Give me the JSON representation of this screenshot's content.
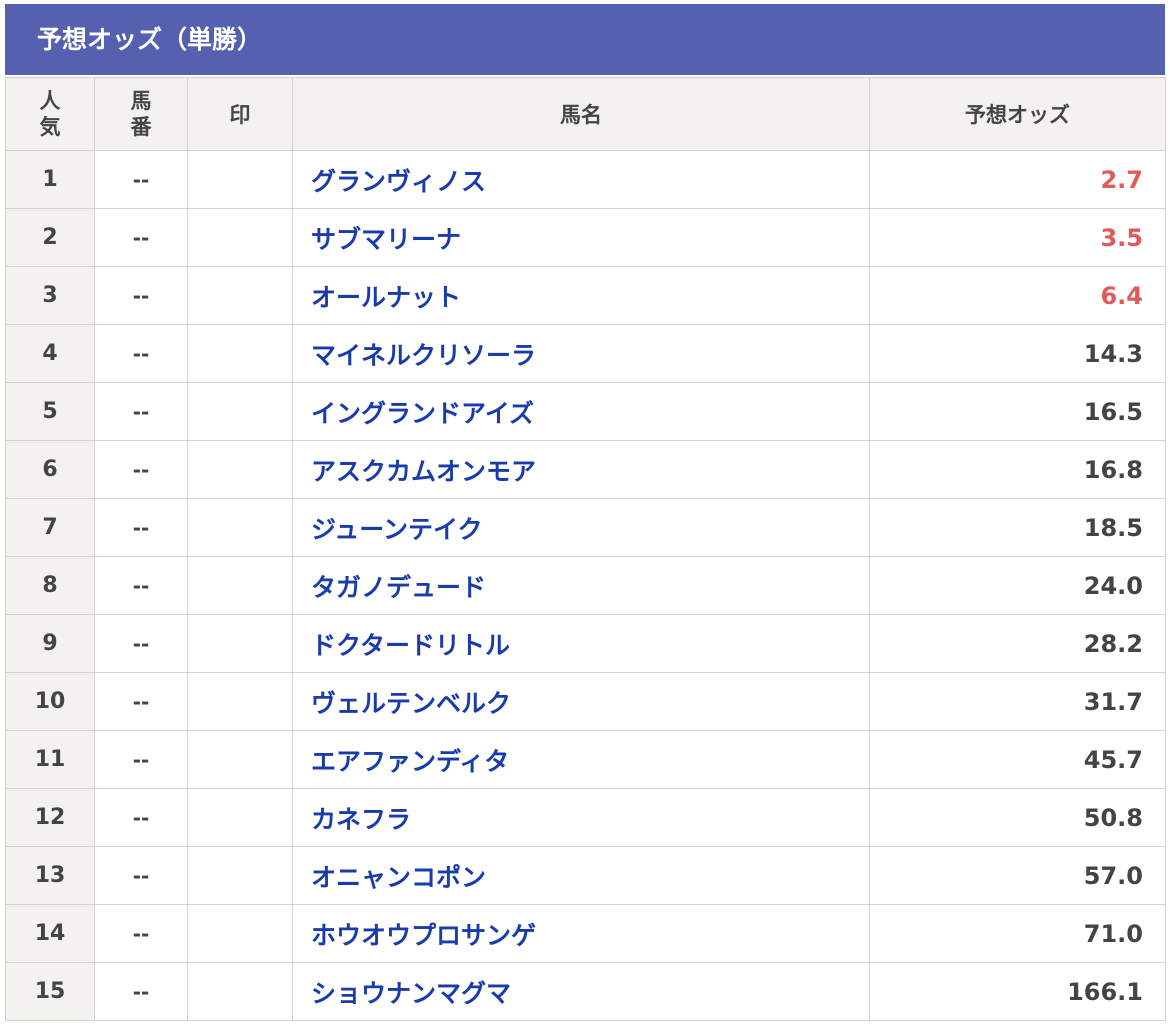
{
  "title": "予想オッズ（単勝）",
  "colors": {
    "header_bg": "#5660b0",
    "favorite_odds": "#df5b5b",
    "horse_link": "#1a3cab"
  },
  "columns": {
    "popularity": [
      "人",
      "気"
    ],
    "horse_number": [
      "馬",
      "番"
    ],
    "mark": "印",
    "horse_name": "馬名",
    "odds": "予想オッズ"
  },
  "rows": [
    {
      "rank": "1",
      "number": "--",
      "mark": "",
      "name": "グランヴィノス",
      "odds": "2.7",
      "highlight": true
    },
    {
      "rank": "2",
      "number": "--",
      "mark": "",
      "name": "サブマリーナ",
      "odds": "3.5",
      "highlight": true
    },
    {
      "rank": "3",
      "number": "--",
      "mark": "",
      "name": "オールナット",
      "odds": "6.4",
      "highlight": true
    },
    {
      "rank": "4",
      "number": "--",
      "mark": "",
      "name": "マイネルクリソーラ",
      "odds": "14.3",
      "highlight": false
    },
    {
      "rank": "5",
      "number": "--",
      "mark": "",
      "name": "イングランドアイズ",
      "odds": "16.5",
      "highlight": false
    },
    {
      "rank": "6",
      "number": "--",
      "mark": "",
      "name": "アスクカムオンモア",
      "odds": "16.8",
      "highlight": false
    },
    {
      "rank": "7",
      "number": "--",
      "mark": "",
      "name": "ジューンテイク",
      "odds": "18.5",
      "highlight": false
    },
    {
      "rank": "8",
      "number": "--",
      "mark": "",
      "name": "タガノデュード",
      "odds": "24.0",
      "highlight": false
    },
    {
      "rank": "9",
      "number": "--",
      "mark": "",
      "name": "ドクタードリトル",
      "odds": "28.2",
      "highlight": false
    },
    {
      "rank": "10",
      "number": "--",
      "mark": "",
      "name": "ヴェルテンベルク",
      "odds": "31.7",
      "highlight": false
    },
    {
      "rank": "11",
      "number": "--",
      "mark": "",
      "name": "エアファンディタ",
      "odds": "45.7",
      "highlight": false
    },
    {
      "rank": "12",
      "number": "--",
      "mark": "",
      "name": "カネフラ",
      "odds": "50.8",
      "highlight": false
    },
    {
      "rank": "13",
      "number": "--",
      "mark": "",
      "name": "オニャンコポン",
      "odds": "57.0",
      "highlight": false
    },
    {
      "rank": "14",
      "number": "--",
      "mark": "",
      "name": "ホウオウプロサンゲ",
      "odds": "71.0",
      "highlight": false
    },
    {
      "rank": "15",
      "number": "--",
      "mark": "",
      "name": "ショウナンマグマ",
      "odds": "166.1",
      "highlight": false
    }
  ]
}
